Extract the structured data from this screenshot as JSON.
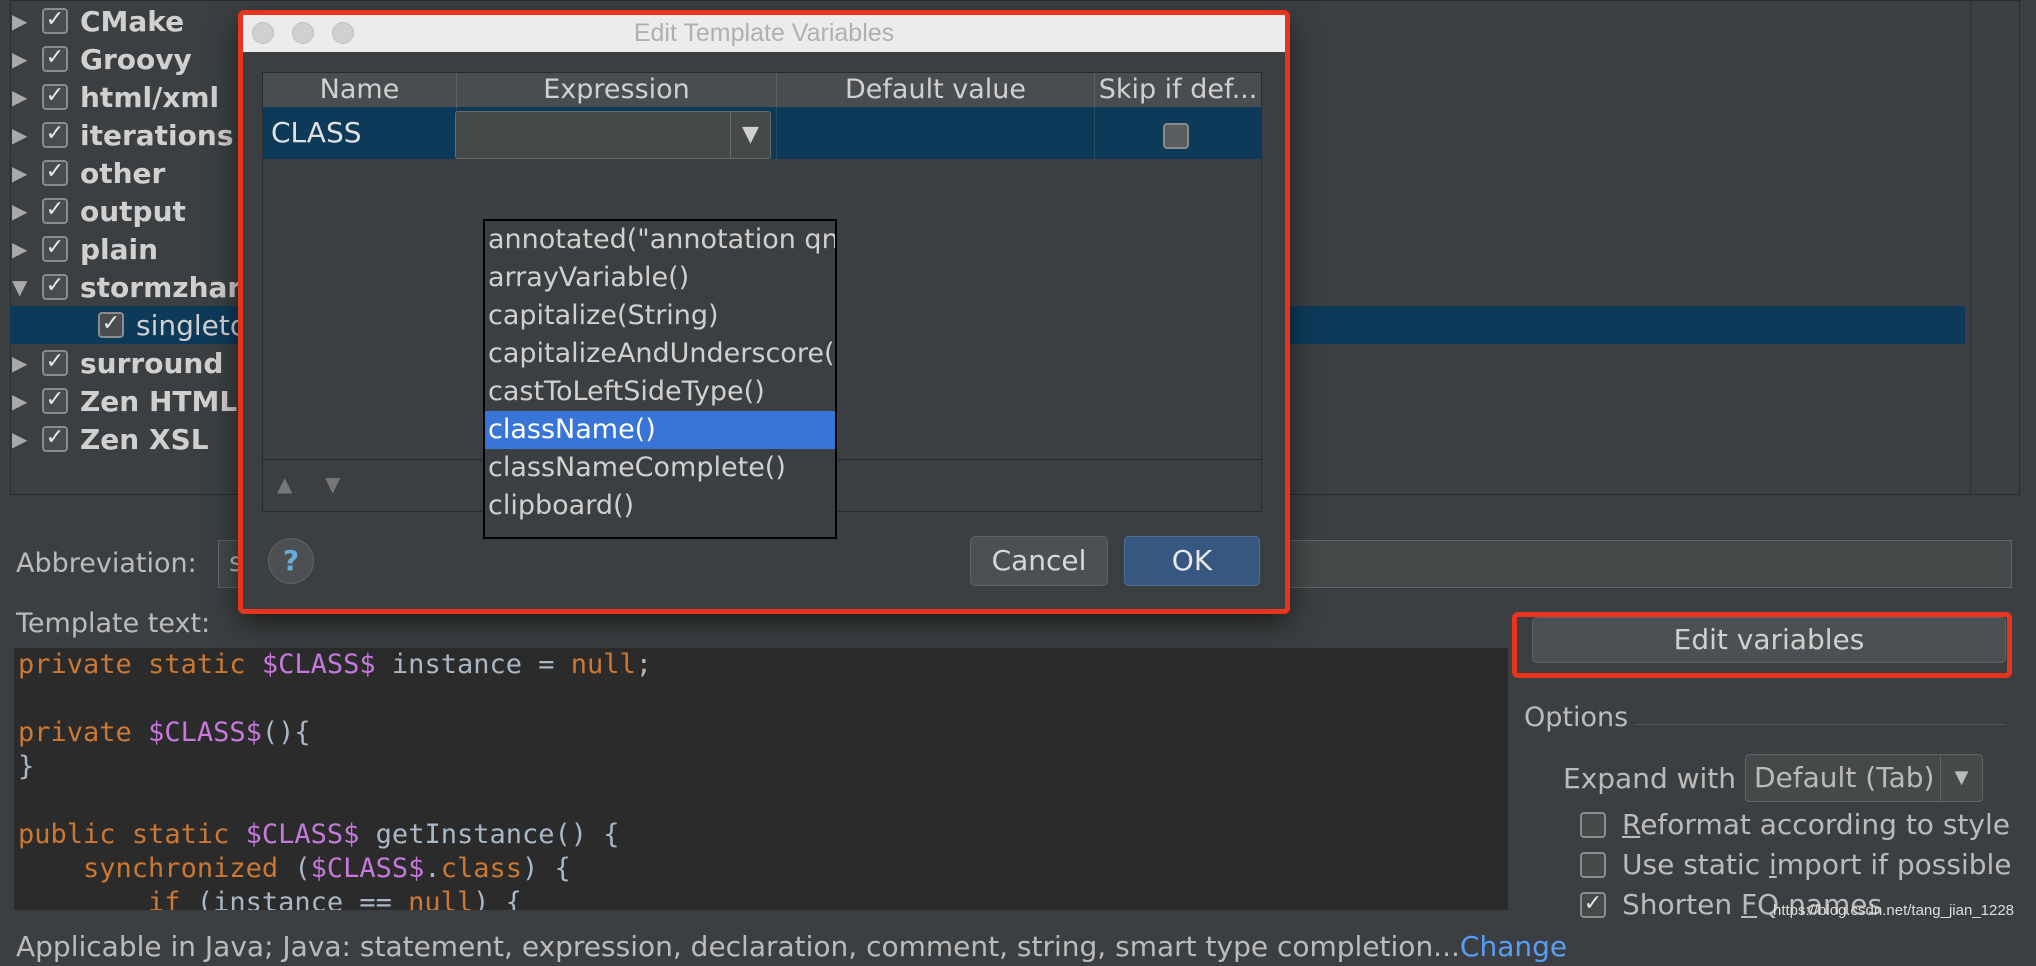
{
  "tree": {
    "items": [
      {
        "label": "CMake",
        "expanded": false,
        "checked": true
      },
      {
        "label": "Groovy",
        "expanded": false,
        "checked": true
      },
      {
        "label": "html/xml",
        "expanded": false,
        "checked": true
      },
      {
        "label": "iterations",
        "expanded": false,
        "checked": true
      },
      {
        "label": "other",
        "expanded": false,
        "checked": true
      },
      {
        "label": "output",
        "expanded": false,
        "checked": true
      },
      {
        "label": "plain",
        "expanded": false,
        "checked": true
      },
      {
        "label": "stormzhar",
        "expanded": true,
        "checked": true
      },
      {
        "label": "singleto",
        "child": true,
        "checked": true
      },
      {
        "label": "surround",
        "expanded": false,
        "checked": true
      },
      {
        "label": "Zen HTML",
        "expanded": false,
        "checked": true
      },
      {
        "label": "Zen XSL",
        "expanded": false,
        "checked": true
      }
    ],
    "expand_glyph": "▶",
    "collapse_glyph": "▼",
    "check_glyph": "✓"
  },
  "abbreviation": {
    "label": "Abbreviation:",
    "value": "s"
  },
  "template": {
    "label": "Template text:",
    "lines": [
      "private static $CLASS$ instance = null;",
      "",
      "private $CLASS$(){",
      "}",
      "",
      "public static $CLASS$ getInstance() {",
      "    synchronized ($CLASS$.class) {",
      "        if (instance == null) {"
    ]
  },
  "applicable": {
    "text": "Applicable in Java; Java: statement, expression, declaration, comment, string, smart type completion...",
    "change_link": "Change"
  },
  "edit_variables_label": "Edit variables",
  "options": {
    "title": "Options",
    "expand_with_label": "Expand with",
    "expand_with_value": "Default (Tab)",
    "reformat": {
      "prefix": "",
      "mnemonic": "R",
      "suffix": "eformat according to style",
      "checked": false
    },
    "static_import": {
      "prefix": "Use static ",
      "mnemonic": "i",
      "suffix": "mport if possible",
      "checked": false
    },
    "shorten_fq": {
      "prefix": "Shorten ",
      "mnemonic": "F",
      "suffix": "Q names",
      "checked": true
    }
  },
  "watermark": "https://blog.csdn.net/tang_jian_1228",
  "dialog": {
    "title": "Edit Template Variables",
    "columns": [
      "Name",
      "Expression",
      "Default value",
      "Skip if def..."
    ],
    "row": {
      "name": "CLASS",
      "expression": "",
      "default_value": "",
      "skip": false
    },
    "dropdown_items": [
      "annotated(\"annotation qn",
      "arrayVariable()",
      "capitalize(String)",
      "capitalizeAndUnderscore(S",
      "castToLeftSideType()",
      "className()",
      "classNameComplete()",
      "clipboard()"
    ],
    "selected_item": "className()",
    "move_up_glyph": "▲",
    "move_down_glyph": "▼",
    "help_label": "?",
    "cancel_label": "Cancel",
    "ok_label": "OK"
  },
  "colors": {
    "background": "#3c3f41",
    "selection": "#0d3a58",
    "highlight_red": "#e8341c",
    "keyword_orange": "#cc7832",
    "variable_purple": "#c679dd",
    "link_blue": "#589df6",
    "list_selected": "#3875d7"
  }
}
